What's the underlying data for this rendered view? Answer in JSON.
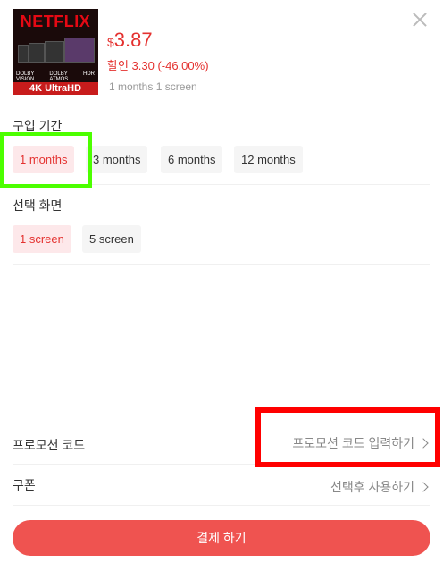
{
  "product": {
    "logo_text": "NETFLIX",
    "badge_text": "4K UltraHD",
    "spec_labels": [
      "DOLBY VISION",
      "DOLBY ATMOS",
      "HDR"
    ],
    "currency": "$",
    "price": "3.87",
    "discount": "할인 3.30 (-46.00%)",
    "selected_variant": "1 months 1 screen"
  },
  "period": {
    "title": "구입 기간",
    "options": [
      "1 months",
      "3 months",
      "6 months",
      "12 months"
    ],
    "selected": "1 months"
  },
  "screen": {
    "title": "선택 화면",
    "options": [
      "1 screen",
      "5 screen"
    ],
    "selected": "1 screen"
  },
  "promo": {
    "label": "프로모션 코드",
    "value": "프로모션 코드 입력하기"
  },
  "coupon": {
    "label": "쿠폰",
    "value": "선택후 사용하기"
  },
  "checkout": {
    "button_label": "결제 하기"
  },
  "colors": {
    "accent": "#e4312f",
    "button": "#ef5350",
    "chip_selected_bg": "#fde8ea",
    "highlight_green": "#4cff00",
    "highlight_red": "#ff0000"
  }
}
